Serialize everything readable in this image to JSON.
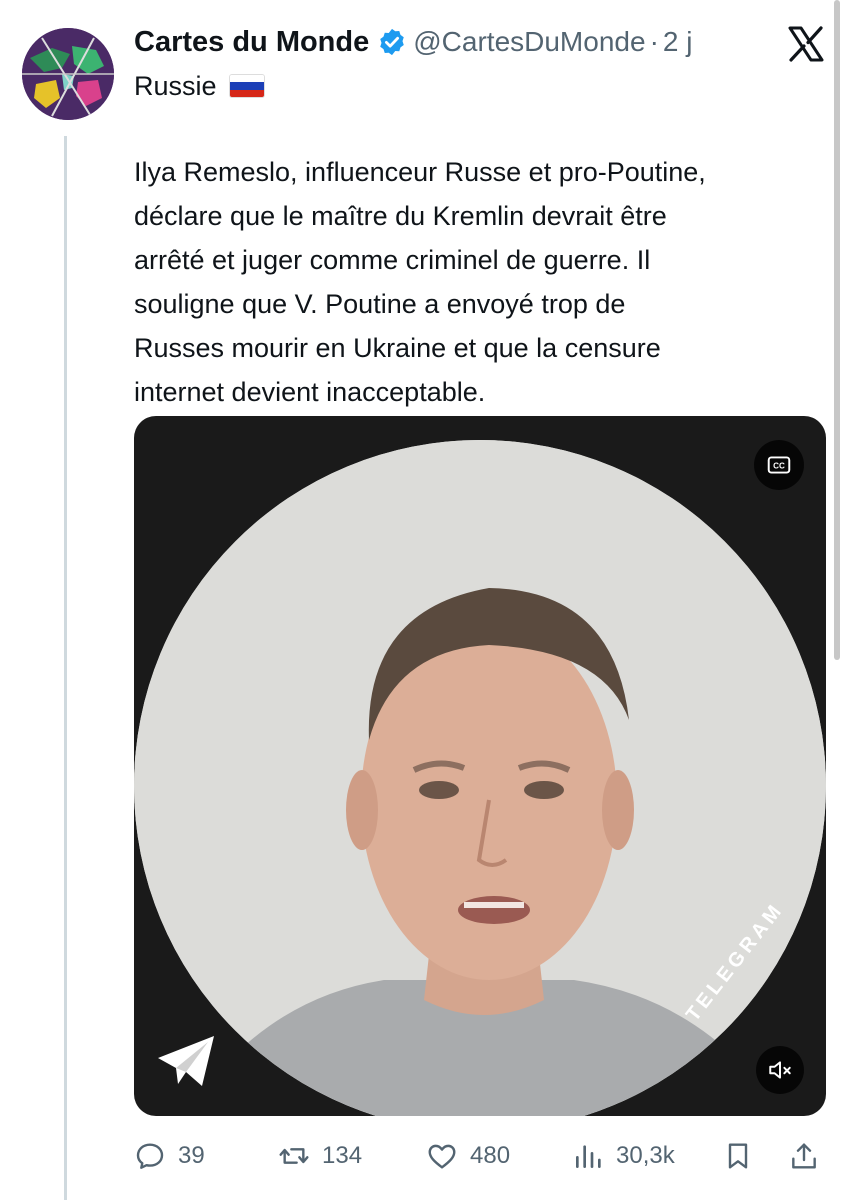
{
  "tweet": {
    "author": {
      "display_name": "Cartes du Monde",
      "handle": "@CartesDuMonde",
      "separator": "·",
      "time": "2 j",
      "verified": true,
      "avatar_icon": "world-map-avatar"
    },
    "platform_icon": "x-logo-icon",
    "subtitle": "Russie",
    "subtitle_flag": "russia-flag-icon",
    "text_lines": [
      "Ilya Remeslo, influenceur Russe et pro-Poutine,",
      "déclare que le maître du Kremlin devrait être",
      "arrêté et juger comme criminel de guerre. Il",
      "souligne que V. Poutine a envoyé trop de",
      "Russes mourir en Ukraine et que la censure",
      "internet devient inacceptable."
    ],
    "media": {
      "type": "video",
      "overlay_label": "TELEGRAM",
      "cc_icon": "closed-captions-icon",
      "mute_icon": "speaker-muted-icon",
      "watermark_icon": "telegram-logo-icon"
    },
    "actions": {
      "replies": "39",
      "reposts": "134",
      "likes": "480",
      "views": "30,3k"
    }
  },
  "colors": {
    "text_primary": "#0f1419",
    "text_secondary": "#536471",
    "verified_blue": "#1d9bf0",
    "thread_line": "#cfd9de",
    "avatar_bg": "#5b2f73"
  }
}
